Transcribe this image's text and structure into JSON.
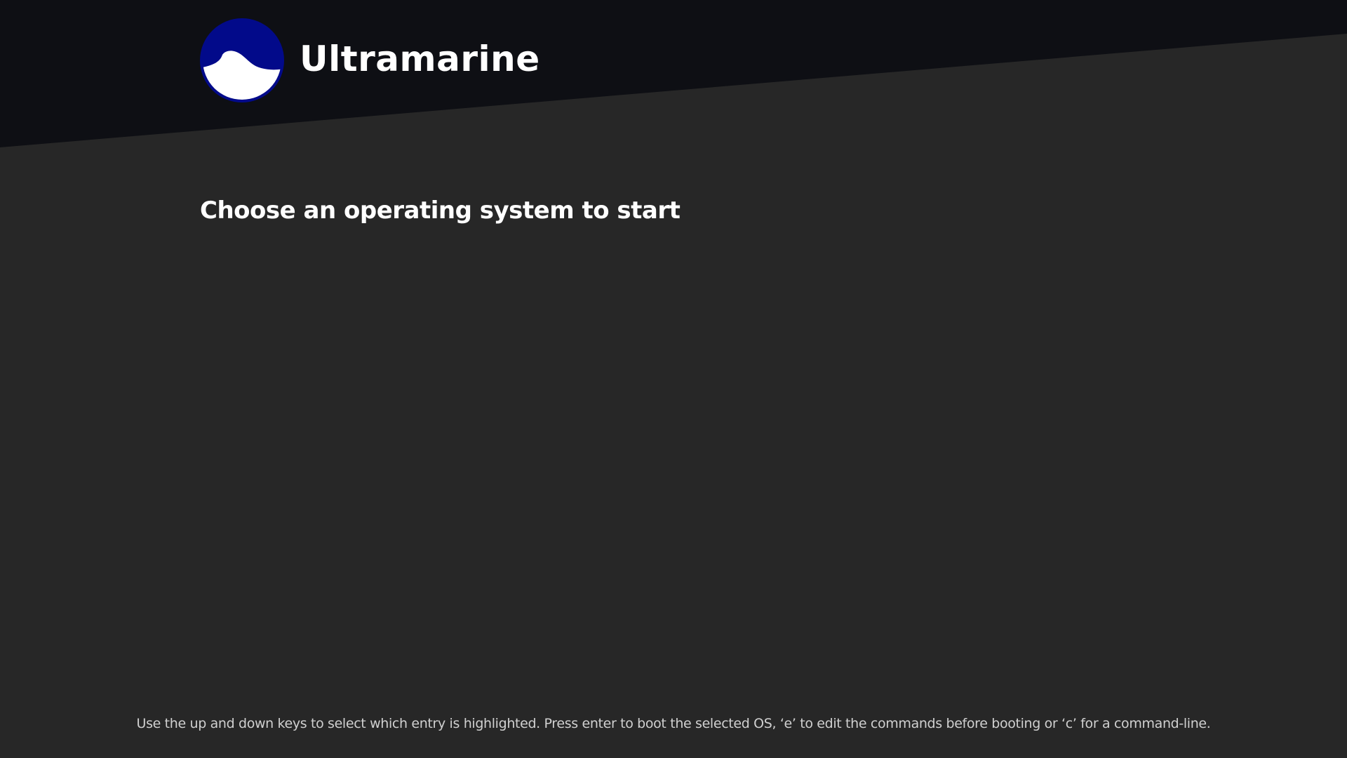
{
  "colors": {
    "background": "#272727",
    "header_band": "#0e0f14",
    "logo_circle": "#020a8a",
    "logo_wave": "#ffffff",
    "text_primary": "#ffffff",
    "text_help": "#d0d0d0"
  },
  "brand": {
    "name": "Ultramarine",
    "logo_icon": "ultramarine-wave-logo"
  },
  "menu": {
    "heading": "Choose an operating system to start",
    "entries": []
  },
  "footer": {
    "help_text": "Use the up and down keys to select which entry is highlighted. Press enter to boot the selected OS, ‘e’ to edit the commands before booting or ‘c’ for a command-line."
  }
}
